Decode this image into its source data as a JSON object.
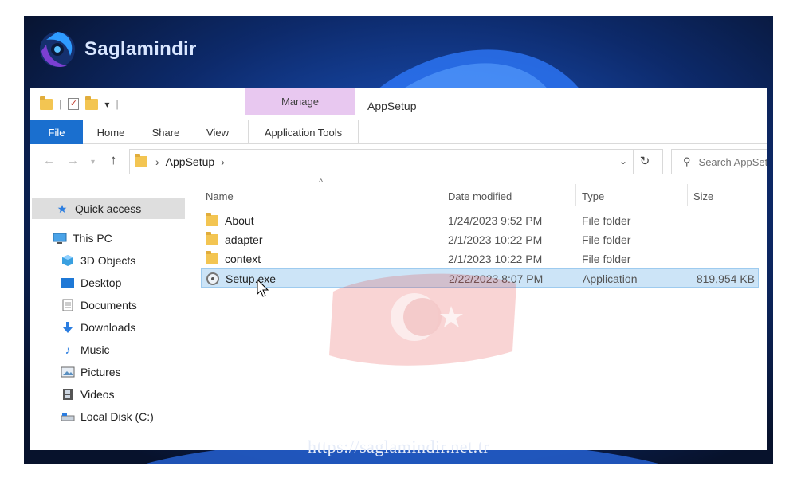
{
  "brand": {
    "name": "Saglamindir"
  },
  "footer": {
    "url": "https://saglamindir.net.tr"
  },
  "window": {
    "title": "AppSetup",
    "contextual_tab_group": "Manage",
    "tabs": [
      "File",
      "Home",
      "Share",
      "View",
      "Application Tools"
    ],
    "address": {
      "crumbs": [
        "AppSetup"
      ]
    },
    "search": {
      "placeholder": "Search AppSetup"
    }
  },
  "nav_pane": {
    "quick_access": "Quick access",
    "this_pc": "This PC",
    "items": [
      "3D Objects",
      "Desktop",
      "Documents",
      "Downloads",
      "Music",
      "Pictures",
      "Videos",
      "Local Disk (C:)"
    ]
  },
  "columns": {
    "name": "Name",
    "date": "Date modified",
    "type": "Type",
    "size": "Size"
  },
  "files": [
    {
      "name": "About",
      "date": "1/24/2023 9:52 PM",
      "type": "File folder",
      "size": "",
      "icon": "folder-icon"
    },
    {
      "name": "adapter",
      "date": "2/1/2023 10:22 PM",
      "type": "File folder",
      "size": "",
      "icon": "folder-icon"
    },
    {
      "name": "context",
      "date": "2/1/2023 10:22 PM",
      "type": "File folder",
      "size": "",
      "icon": "folder-icon"
    },
    {
      "name": "Setup.exe",
      "date": "2/22/2023 8:07 PM",
      "type": "Application",
      "size": "819,954 KB",
      "icon": "setup-app-icon",
      "selected": true
    }
  ],
  "colors": {
    "file_tab": "#1a6fcf",
    "manage_tab": "#e8c8f0",
    "selection": "#cce4f7",
    "folder": "#f3c552"
  }
}
